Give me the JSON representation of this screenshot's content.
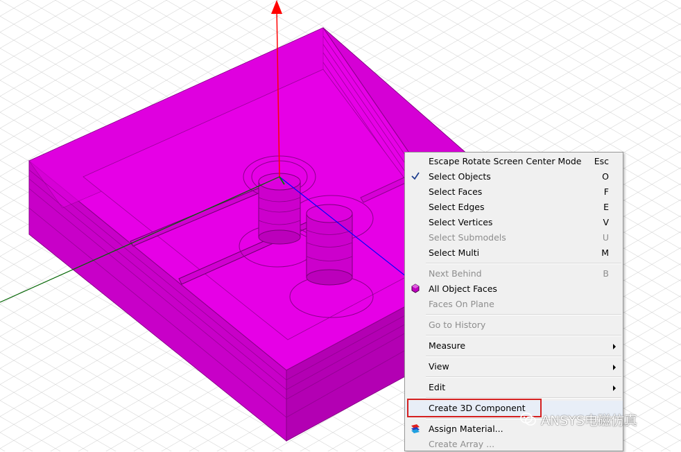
{
  "viewport": {
    "model_color": "#e600e6",
    "axes": {
      "z_color": "#ff0000",
      "x_color": "#0000ff",
      "y_color": "#006400"
    }
  },
  "context_menu": {
    "items": [
      {
        "label": "Escape Rotate Screen Center Mode",
        "shortcut": "Esc",
        "enabled": true
      },
      {
        "label": "Select Objects",
        "shortcut": "O",
        "enabled": true,
        "checked": true
      },
      {
        "label": "Select Faces",
        "shortcut": "F",
        "enabled": true
      },
      {
        "label": "Select Edges",
        "shortcut": "E",
        "enabled": true
      },
      {
        "label": "Select Vertices",
        "shortcut": "V",
        "enabled": true
      },
      {
        "label": "Select Submodels",
        "shortcut": "U",
        "enabled": false
      },
      {
        "label": "Select Multi",
        "shortcut": "M",
        "enabled": true
      },
      {
        "label": "Next Behind",
        "shortcut": "B",
        "enabled": false
      },
      {
        "label": "All Object Faces",
        "shortcut": "",
        "enabled": true,
        "icon": "hexagon-icon"
      },
      {
        "label": "Faces On Plane",
        "shortcut": "",
        "enabled": false
      },
      {
        "label": "Go to History",
        "shortcut": "",
        "enabled": false
      },
      {
        "label": "Measure",
        "shortcut": "",
        "enabled": true,
        "submenu": true
      },
      {
        "label": "View",
        "shortcut": "",
        "enabled": true,
        "submenu": true
      },
      {
        "label": "Edit",
        "shortcut": "",
        "enabled": true,
        "submenu": true
      },
      {
        "label": "Create 3D Component",
        "shortcut": "",
        "enabled": true,
        "highlighted": true
      },
      {
        "label": "Assign Material...",
        "shortcut": "",
        "enabled": true,
        "icon": "material-icon"
      },
      {
        "label": "Create Array ...",
        "shortcut": "",
        "enabled": false
      }
    ]
  },
  "watermark": {
    "text": "ANSYS电磁仿真"
  }
}
